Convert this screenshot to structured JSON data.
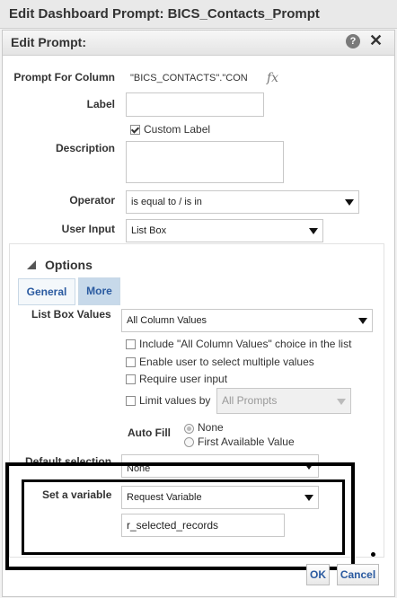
{
  "window": {
    "title": "Edit Dashboard Prompt: BICS_Contacts_Prompt"
  },
  "dialog": {
    "title": "Edit Prompt:",
    "help_icon": "?",
    "close_icon": "✕"
  },
  "form": {
    "prompt_for_column_label": "Prompt For Column",
    "prompt_for_column_value": "\"BICS_CONTACTS\".\"CON",
    "fx_label": "fx",
    "label_label": "Label",
    "label_value": "",
    "custom_label_text": "Custom Label",
    "custom_label_checked": true,
    "description_label": "Description",
    "description_value": "",
    "operator_label": "Operator",
    "operator_value": "is equal to / is in",
    "user_input_label": "User Input",
    "user_input_value": "List Box"
  },
  "options": {
    "title": "Options",
    "tabs": [
      {
        "label": "General",
        "active": false
      },
      {
        "label": "More",
        "active": true
      }
    ],
    "list_box_values_label": "List Box Values",
    "list_box_values_value": "All Column Values",
    "checkboxes": [
      {
        "label": "Include \"All Column Values\" choice in the list",
        "checked": false
      },
      {
        "label": "Enable user to select multiple values",
        "checked": false
      },
      {
        "label": "Require user input",
        "checked": false
      },
      {
        "label": "Limit values by",
        "checked": false
      }
    ],
    "limit_values_select": "All Prompts",
    "auto_fill_label": "Auto Fill",
    "auto_fill_options": [
      {
        "label": "None",
        "selected": true
      },
      {
        "label": "First Available Value",
        "selected": false
      }
    ],
    "default_selection_label": "Default selection",
    "default_selection_value": "None",
    "set_variable_label": "Set a variable",
    "set_variable_value": "Request Variable",
    "variable_name_value": "r_selected_records"
  },
  "buttons": {
    "ok": "OK",
    "cancel": "Cancel"
  }
}
